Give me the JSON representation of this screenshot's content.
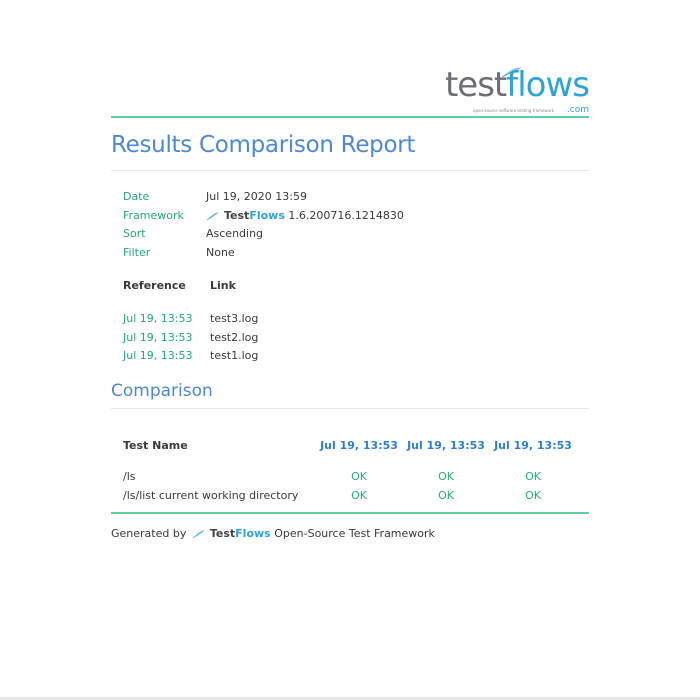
{
  "logo": {
    "word_test": "test",
    "word_flows": "flows",
    "tagline": "open-source software testing framework",
    "domain": ".com"
  },
  "report": {
    "title": "Results Comparison Report"
  },
  "meta": {
    "date_label": "Date",
    "date_value": "Jul 19, 2020 13:59",
    "framework_label": "Framework",
    "framework_name_test": "Test",
    "framework_name_flows": "Flows",
    "framework_version": "1.6.200716.1214830",
    "sort_label": "Sort",
    "sort_value": "Ascending",
    "filter_label": "Filter",
    "filter_value": "None"
  },
  "references": {
    "header_reference": "Reference",
    "header_link": "Link",
    "rows": [
      {
        "date": "Jul 19, 13:53",
        "link": "test3.log"
      },
      {
        "date": "Jul 19, 13:53",
        "link": "test2.log"
      },
      {
        "date": "Jul 19, 13:53",
        "link": "test1.log"
      }
    ]
  },
  "comparison": {
    "title": "Comparison",
    "header_test_name": "Test Name",
    "columns": [
      "Jul 19, 13:53",
      "Jul 19, 13:53",
      "Jul 19, 13:53"
    ],
    "rows": [
      {
        "name": "/ls",
        "results": [
          "OK",
          "OK",
          "OK"
        ]
      },
      {
        "name": "/ls/list current working directory",
        "results": [
          "OK",
          "OK",
          "OK"
        ]
      }
    ]
  },
  "footer": {
    "prefix": "Generated by",
    "name_test": "Test",
    "name_flows": "Flows",
    "suffix": "Open-Source Test Framework"
  },
  "colors": {
    "accent_blue": "#4c88d6",
    "label_green": "#22a87a",
    "ok_green": "#22b36b",
    "rule_green": "#5fcf9c",
    "brand_blue": "#2fa3d8"
  },
  "icons": {
    "logo_feather": "feather-icon",
    "framework_feather": "feather-icon",
    "footer_feather": "feather-icon"
  }
}
